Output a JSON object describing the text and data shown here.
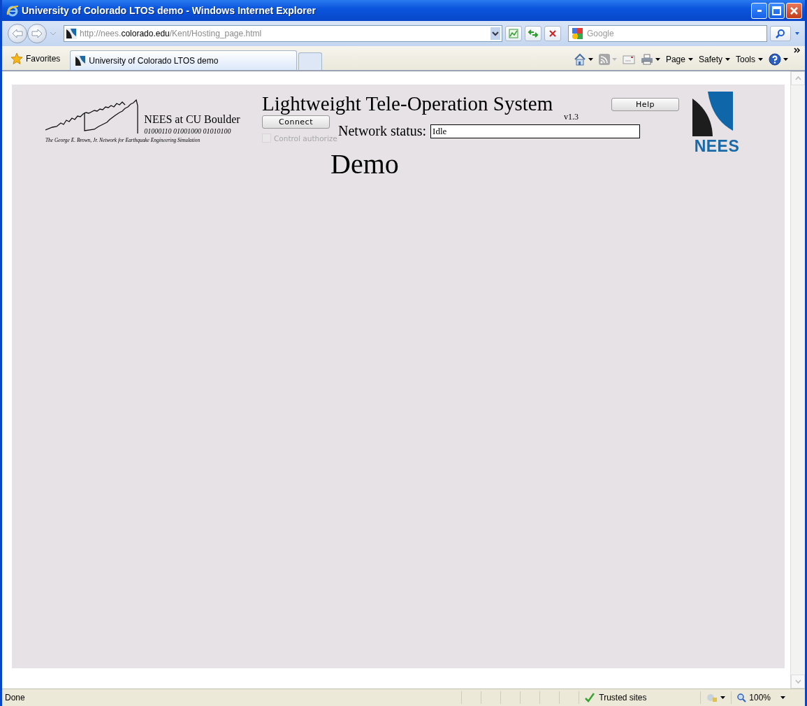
{
  "window": {
    "title": "University of Colorado LTOS demo - Windows Internet Explorer"
  },
  "address_bar": {
    "url_parts": [
      {
        "text": "http://nees.",
        "kind": "dim"
      },
      {
        "text": "colorado.edu",
        "kind": "domain"
      },
      {
        "text": "/Kent/Hosting_page.html",
        "kind": "dim"
      }
    ]
  },
  "search": {
    "placeholder": "Google"
  },
  "favorites": "Favorites",
  "tabs": [
    {
      "label": "University of Colorado LTOS demo",
      "selected": true
    }
  ],
  "command_bar": [
    "Page",
    "Safety",
    "Tools"
  ],
  "page": {
    "logo": {
      "title": "NEES at CU Boulder",
      "binary": "01000110 01001000 01010100",
      "caption": "The George E. Brown, Jr. Network for Earthquake Engineering Simulation"
    },
    "app_title": "Lightweight Tele-Operation System",
    "version": "v1.3",
    "connect_button": "Connect",
    "help_button": "Help",
    "control_checkbox": {
      "label": "Control authorize",
      "checked": false,
      "disabled": true
    },
    "network_status": {
      "label": "Network status:",
      "value": "Idle"
    },
    "nees_logo": "NEES",
    "heading": "Demo"
  },
  "status_bar": {
    "text": "Done",
    "zone": "Trusted sites",
    "zoom": "100%"
  }
}
